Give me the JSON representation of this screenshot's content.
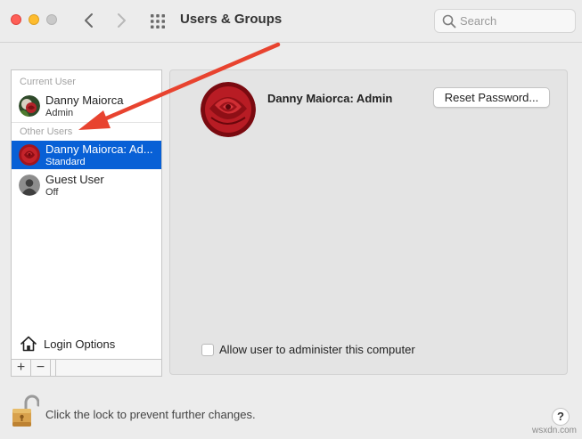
{
  "window": {
    "title": "Users & Groups",
    "search_placeholder": "Search",
    "search_value": ""
  },
  "sidebar": {
    "current_user_label": "Current User",
    "other_users_label": "Other Users",
    "users": [
      {
        "name": "Danny Maiorca",
        "role": "Admin",
        "avatar": "rose-green-avatar",
        "selected": false
      },
      {
        "name": "Danny Maiorca: Ad...",
        "role": "Standard",
        "avatar": "red-rose-avatar",
        "selected": true
      },
      {
        "name": "Guest User",
        "role": "Off",
        "avatar": "generic-person-avatar",
        "selected": false
      }
    ],
    "login_options_label": "Login Options",
    "add_label": "+",
    "remove_label": "−"
  },
  "detail": {
    "user_name": "Danny Maiorca: Admin",
    "reset_password_label": "Reset Password...",
    "allow_admin_label": "Allow user to administer this computer",
    "allow_admin_checked": false
  },
  "footer": {
    "lock_text": "Click the lock to prevent further changes.",
    "help_label": "?",
    "watermark": "wsxdn.com"
  },
  "colors": {
    "selection": "#0860d6",
    "annotation_arrow": "#e8432f",
    "panel_bg": "#e4e4e4"
  }
}
